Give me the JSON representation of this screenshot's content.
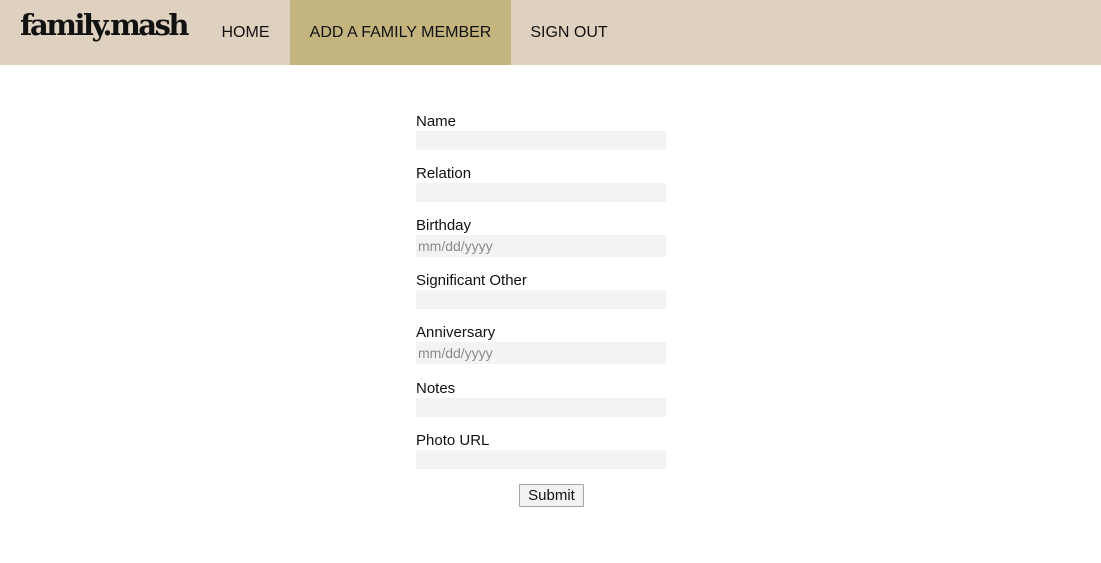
{
  "header": {
    "logo": "family.mash",
    "nav": {
      "home": "HOME",
      "add_member": "ADD A FAMILY MEMBER",
      "sign_out": "SIGN OUT"
    },
    "active_item": "ADD A FAMILY MEMBER",
    "colors": {
      "bar": "#dfd1c0",
      "active": "#c4b47e"
    }
  },
  "form": {
    "name": {
      "label": "Name",
      "value": ""
    },
    "relation": {
      "label": "Relation",
      "value": ""
    },
    "birthday": {
      "label": "Birthday",
      "placeholder": "mm/dd/yyyy"
    },
    "significant_other": {
      "label": "Significant Other",
      "value": ""
    },
    "anniversary": {
      "label": "Anniversary",
      "placeholder": "mm/dd/yyyy"
    },
    "notes": {
      "label": "Notes",
      "value": ""
    },
    "photo_url": {
      "label": "Photo URL",
      "value": ""
    },
    "submit_label": "Submit"
  }
}
